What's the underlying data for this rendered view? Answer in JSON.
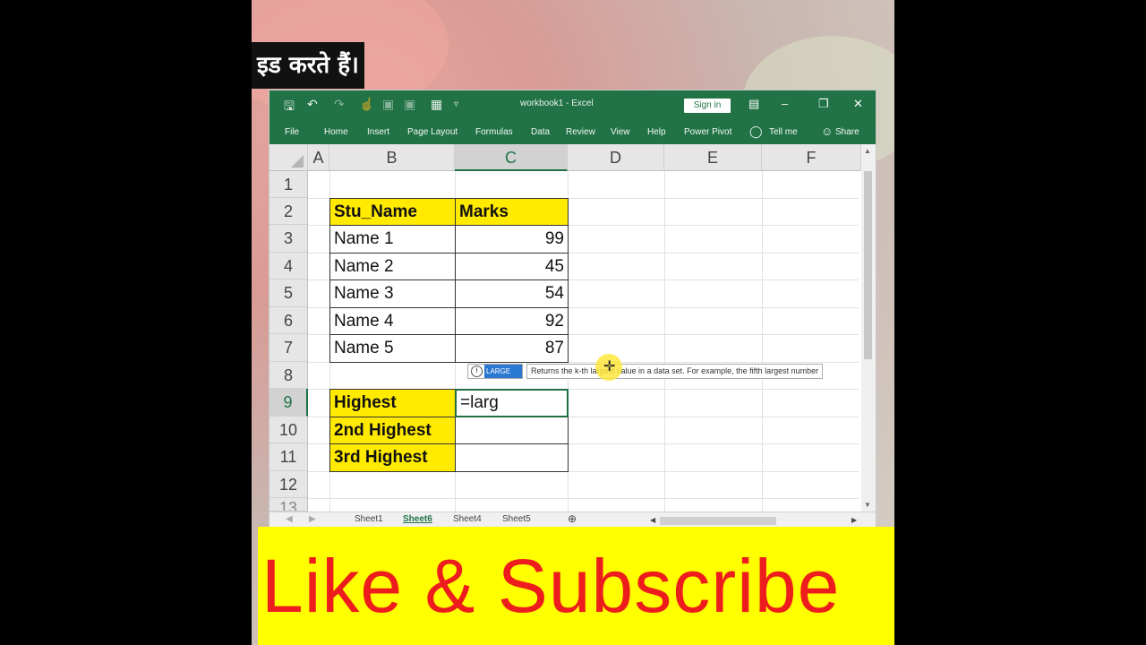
{
  "overlay": {
    "hindi_caption": "इड करते हैं।",
    "banner_text": "Like & Subscribe"
  },
  "window": {
    "title": "workbook1  -  Excel",
    "sign_in": "Sign in",
    "ribbon_tabs": [
      "File",
      "Home",
      "Insert",
      "Page Layout",
      "Formulas",
      "Data",
      "Review",
      "View",
      "Help",
      "Power Pivot",
      "Tell me",
      "Share"
    ]
  },
  "sheet": {
    "columns": [
      "A",
      "B",
      "C",
      "D",
      "E",
      "F"
    ],
    "rows": [
      "1",
      "2",
      "3",
      "4",
      "5",
      "6",
      "7",
      "8",
      "9",
      "10",
      "11",
      "12"
    ],
    "header": {
      "name": "Stu_Name",
      "marks": "Marks"
    },
    "students": [
      {
        "name": "Name 1",
        "marks": "99"
      },
      {
        "name": "Name 2",
        "marks": "45"
      },
      {
        "name": "Name 3",
        "marks": "54"
      },
      {
        "name": "Name 4",
        "marks": "92"
      },
      {
        "name": "Name 5",
        "marks": "87"
      }
    ],
    "labels": {
      "highest": "Highest",
      "second": "2nd Highest",
      "third": "3rd Highest"
    },
    "active_cell_value": "=larg"
  },
  "autocomplete": {
    "function_name": "LARGE",
    "description": "Returns the k-th largest value in a data set. For example, the fifth largest number"
  },
  "sheet_tabs": [
    "Sheet1",
    "Sheet6",
    "Sheet4",
    "Sheet5"
  ],
  "colors": {
    "excel_green": "#217346",
    "highlight_yellow": "#ffea00",
    "banner_red": "#ee1d1d",
    "banner_bg": "#ffff00"
  }
}
